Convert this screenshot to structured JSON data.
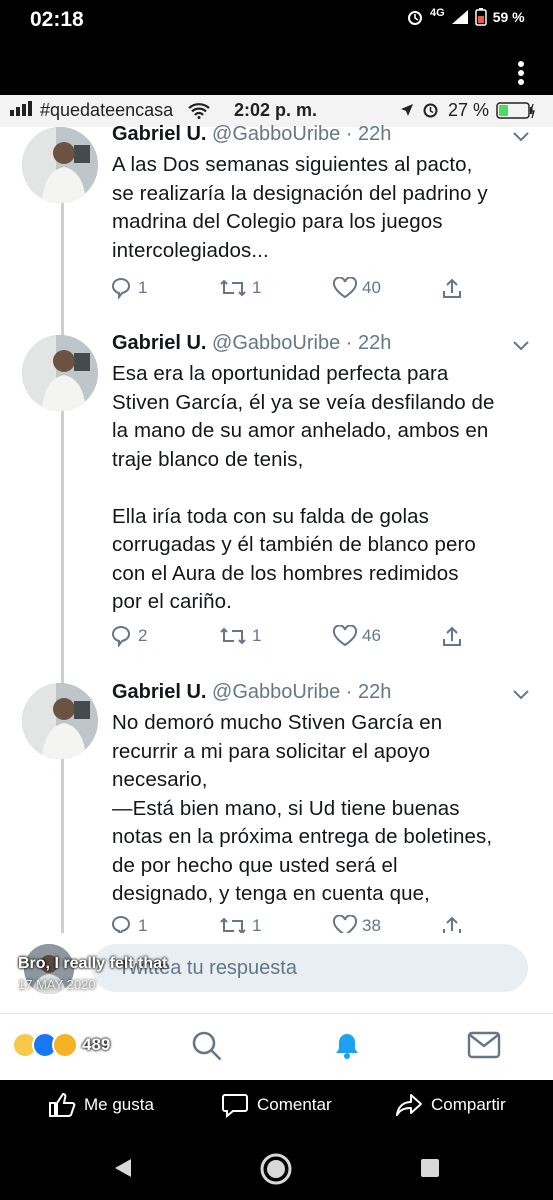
{
  "phone_status": {
    "time": "02:18",
    "network": "4G",
    "battery": "59 %"
  },
  "inner_status": {
    "carrier": "#quedateencasa",
    "time": "2:02 p. m.",
    "battery": "27 %"
  },
  "tweets": [
    {
      "name": "Gabriel U.",
      "handle": "@GabboUribe · 22h",
      "text": "A las Dos semanas siguientes al pacto,\nse realizaría la designación del padrino y\nmadrina del Colegio para los juegos\nintercolegiados...",
      "replies": "1",
      "retweets": "1",
      "likes": "40"
    },
    {
      "name": "Gabriel U.",
      "handle": "@GabboUribe · 22h",
      "text": "Esa era la oportunidad perfecta para\nStiven García, él ya se veía desfilando de\nla mano de su amor anhelado, ambos en\ntraje blanco de tenis,\n\nElla iría toda con su falda de golas\ncorrugadas y él también de blanco pero\ncon el Aura de los hombres redimidos\npor el cariño.",
      "replies": "2",
      "retweets": "1",
      "likes": "46"
    },
    {
      "name": "Gabriel U.",
      "handle": "@GabboUribe · 22h",
      "text": "No demoró mucho Stiven García en\nrecurrir a mi para solicitar el apoyo\nnecesario,\n—Está bien mano, si Ud tiene buenas\nnotas en la próxima entrega de boletines,\nde por hecho que usted será el\ndesignado, y tenga en cuenta que,",
      "replies": "1",
      "retweets": "1",
      "likes": "38"
    }
  ],
  "reply": {
    "placeholder": "Twittea tu respuesta"
  },
  "story_overlay": {
    "caption": "Bro, I really felt that",
    "date": "17 MAY 2020"
  },
  "reactions": {
    "count": "489"
  },
  "facebook_actions": {
    "like": "Me gusta",
    "comment": "Comentar",
    "share": "Compartir"
  },
  "colors": {
    "twitter_blue": "#1da1f2",
    "text": "#14171a",
    "muted": "#657786"
  }
}
